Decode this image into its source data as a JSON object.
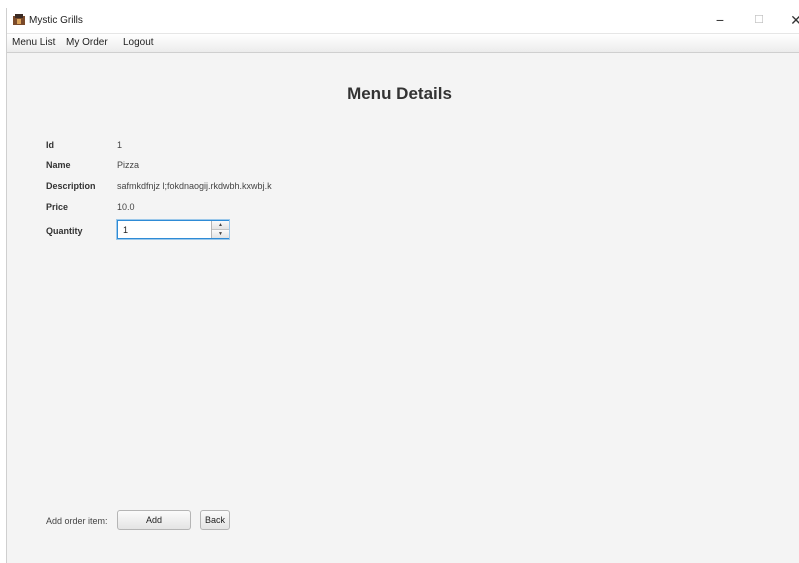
{
  "window": {
    "title": "Mystic Grills",
    "controls": {
      "minimize": "−",
      "maximize": "☐",
      "close": "✕"
    }
  },
  "menubar": {
    "items": [
      {
        "label": "Menu List"
      },
      {
        "label": "My Order"
      },
      {
        "label": "Logout"
      }
    ]
  },
  "page": {
    "title": "Menu Details"
  },
  "details": {
    "id_label": "Id",
    "id_value": "1",
    "name_label": "Name",
    "name_value": "Pizza",
    "description_label": "Description",
    "description_value": "safmkdfnjz l;fokdnaogij.rkdwbh.kxwbj.k",
    "price_label": "Price",
    "price_value": "10.0",
    "quantity_label": "Quantity",
    "quantity_value": "1"
  },
  "footer": {
    "add_order_label": "Add order item:",
    "add_button": "Add",
    "back_button": "Back"
  },
  "colors": {
    "background": "#f4f4f4",
    "focus_border": "#2e8bd6"
  },
  "icons": {
    "app": "app-logo-icon",
    "spinner_up": "arrow-up-icon",
    "spinner_down": "arrow-down-icon"
  }
}
